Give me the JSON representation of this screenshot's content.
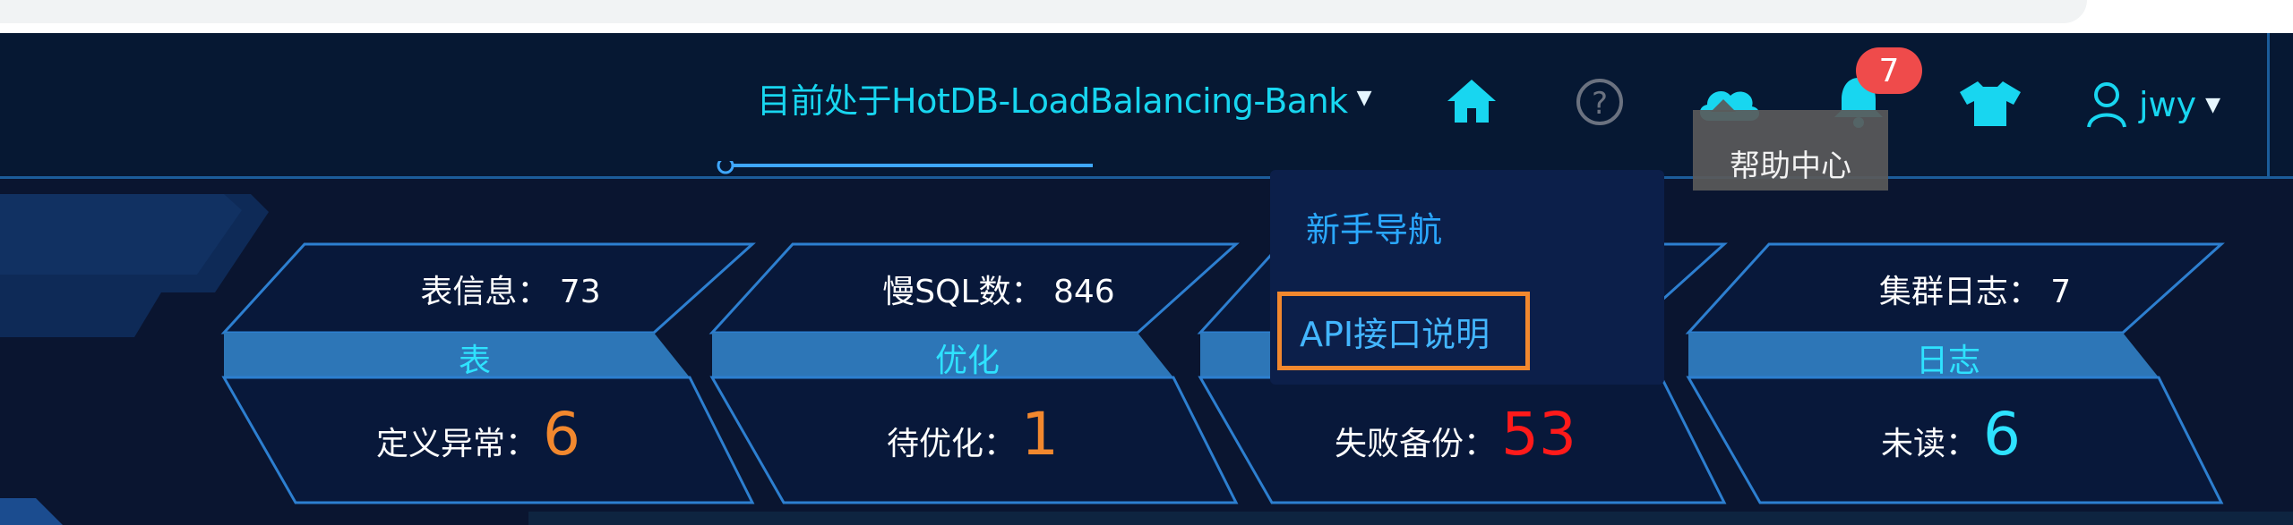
{
  "header": {
    "cluster_label": "目前处于HotDB-LoadBalancing-Bank",
    "notification_count": "7",
    "username": "jwy"
  },
  "tooltip": {
    "text": "帮助中心"
  },
  "help_menu": {
    "items": [
      {
        "label": "新手导航"
      },
      {
        "label": "API接口说明"
      }
    ]
  },
  "cards": [
    {
      "top": "表信息： 73",
      "middle": "表",
      "bottom_label": "定义异常：",
      "bottom_value": "6",
      "value_color": "#f2882e"
    },
    {
      "top": "慢SQL数： 846",
      "middle": "优化",
      "bottom_label": "待优化：",
      "bottom_value": "1",
      "value_color": "#f2882e"
    },
    {
      "top": "",
      "middle": "",
      "bottom_label": "失败备份：",
      "bottom_value": "53",
      "value_color": "#ff1a1a"
    },
    {
      "top": "集群日志： 7",
      "middle": "日志",
      "bottom_label": "未读：",
      "bottom_value": "6",
      "value_color": "#2ee2ff"
    }
  ],
  "icons": [
    "home-icon",
    "help-icon",
    "cloud-icon",
    "bell-icon",
    "shirt-icon",
    "user-icon"
  ],
  "colors": {
    "accent": "#18d6f0",
    "panel_band": "#2d76b7",
    "background": "#0a1530",
    "warning": "#f2882e",
    "danger": "#ff1a1a"
  }
}
